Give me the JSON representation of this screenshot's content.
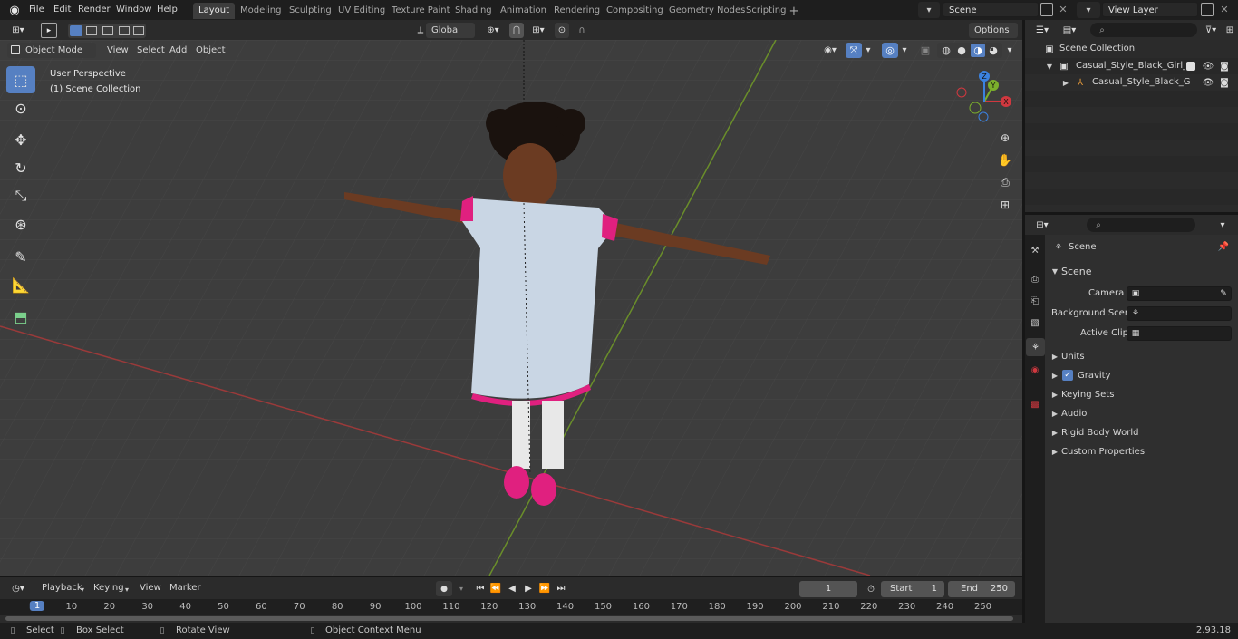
{
  "topbar": {
    "menus": [
      "File",
      "Edit",
      "Render",
      "Window",
      "Help"
    ],
    "workspaces": [
      "Layout",
      "Modeling",
      "Sculpting",
      "UV Editing",
      "Texture Paint",
      "Shading",
      "Animation",
      "Rendering",
      "Compositing",
      "Geometry Nodes",
      "Scripting"
    ],
    "active_workspace": "Layout",
    "scene_value": "Scene",
    "view_layer_value": "View Layer"
  },
  "viewport": {
    "mode": "Object Mode",
    "menu_view": "View",
    "menu_select": "Select",
    "menu_add": "Add",
    "menu_object": "Object",
    "transform_orientation": "Global",
    "options_label": "Options",
    "overlay_line1": "User Perspective",
    "overlay_line2": "(1) Scene Collection",
    "gizmo_axes": [
      "X",
      "Y",
      "Z"
    ]
  },
  "outliner": {
    "root": "Scene Collection",
    "item1": "Casual_Style_Black_Girl_Chilc",
    "item2": "Casual_Style_Black_Girl_"
  },
  "properties": {
    "header": "Scene",
    "section": "Scene",
    "camera_label": "Camera",
    "background_scene_label": "Background Scene",
    "active_clip_label": "Active Clip",
    "panels": [
      "Units",
      "Gravity",
      "Keying Sets",
      "Audio",
      "Rigid Body World",
      "Custom Properties"
    ],
    "gravity_checked": true
  },
  "timeline": {
    "menu_playback": "Playback",
    "menu_keying": "Keying",
    "menu_view": "View",
    "menu_marker": "Marker",
    "current_frame": "1",
    "start_label": "Start",
    "start_value": "1",
    "end_label": "End",
    "end_value": "250",
    "ruler_ticks": [
      "1",
      "10",
      "20",
      "30",
      "40",
      "50",
      "60",
      "70",
      "80",
      "90",
      "100",
      "110",
      "120",
      "130",
      "140",
      "150",
      "160",
      "170",
      "180",
      "190",
      "200",
      "210",
      "220",
      "230",
      "240",
      "250"
    ]
  },
  "statusbar": {
    "select": "Select",
    "box_select": "Box Select",
    "rotate_view": "Rotate View",
    "context_menu": "Object Context Menu",
    "version": "2.93.18"
  },
  "colors": {
    "accent": "#5680c2",
    "x_axis": "#d0383f",
    "y_axis": "#7bb02c",
    "z_axis": "#3b82e0",
    "dress": "#c9d6e4",
    "trim": "#e0207f"
  }
}
